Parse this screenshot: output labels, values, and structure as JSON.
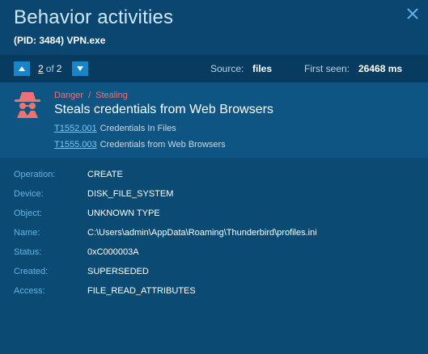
{
  "header": {
    "title": "Behavior activities",
    "pid_label": "(PID: 3484) VPN.exe"
  },
  "nav": {
    "current": "2",
    "of_label": "of",
    "total": "2",
    "source_label": "Source:",
    "source_value": "files",
    "first_seen_label": "First seen:",
    "first_seen_value": "26468 ms"
  },
  "threat": {
    "level": "Danger",
    "category": "Stealing",
    "separator": "/",
    "title": "Steals credentials from Web Browsers",
    "techniques": [
      {
        "id": "T1552.001",
        "name": "Credentials In Files"
      },
      {
        "id": "T1555.003",
        "name": "Credentials from Web Browsers"
      }
    ]
  },
  "details": [
    {
      "key": "Operation:",
      "value": "CREATE"
    },
    {
      "key": "Device:",
      "value": "DISK_FILE_SYSTEM"
    },
    {
      "key": "Object:",
      "value": "UNKNOWN TYPE"
    },
    {
      "key": "Name:",
      "value": "C:\\Users\\admin\\AppData\\Roaming\\Thunderbird\\profiles.ini"
    },
    {
      "key": "Status:",
      "value": "0xC000003A"
    },
    {
      "key": "Created:",
      "value": "SUPERSEDED"
    },
    {
      "key": "Access:",
      "value": "FILE_READ_ATTRIBUTES"
    }
  ],
  "icons": {
    "close": "close-icon",
    "prev": "arrow-up-icon",
    "next": "arrow-down-icon",
    "threat": "spy-icon"
  },
  "colors": {
    "background": "#0b4b73",
    "danger": "#ee7272",
    "accent": "#1a84c4",
    "label": "#5fb5ea"
  }
}
